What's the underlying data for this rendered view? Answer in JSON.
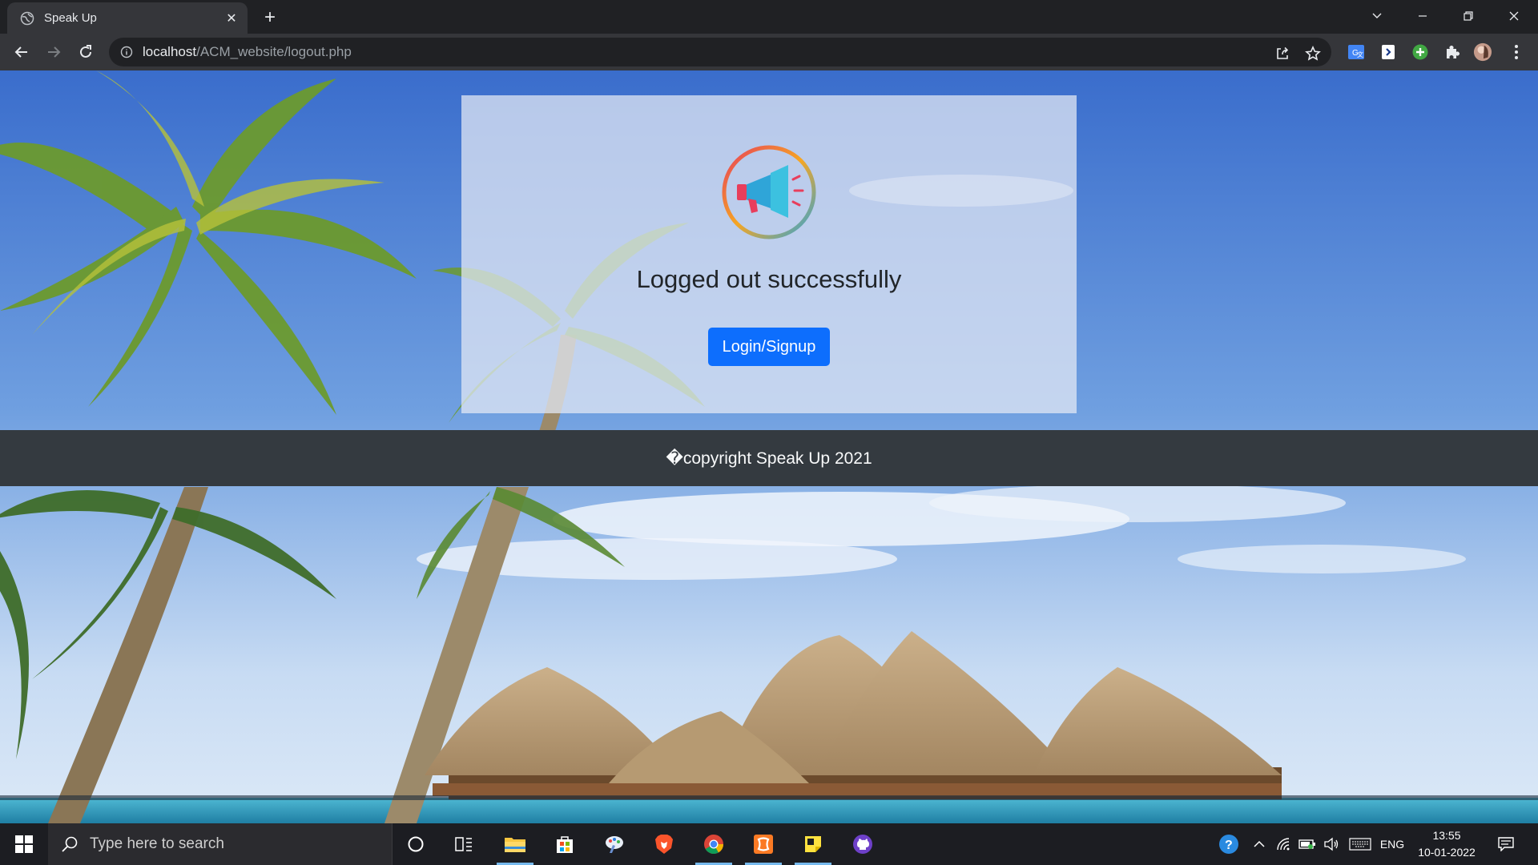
{
  "browser": {
    "tab_title": "Speak Up",
    "url_host": "localhost",
    "url_path": "/ACM_website/logout.php"
  },
  "page": {
    "heading": "Logged out successfully",
    "login_button": "Login/Signup",
    "footer_text": "�copyright Speak Up 2021"
  },
  "taskbar": {
    "search_placeholder": "Type here to search",
    "language": "ENG",
    "time": "13:55",
    "date": "10-01-2022"
  },
  "colors": {
    "primary_button": "#0d6efd",
    "footer_bg": "#343a40",
    "chrome_dark": "#202124",
    "chrome_toolbar": "#35363a"
  },
  "icons": [
    "globe-icon",
    "close-icon",
    "plus-icon",
    "back-icon",
    "forward-icon",
    "reload-icon",
    "info-icon",
    "share-icon",
    "star-icon",
    "translate-icon",
    "extension-icon",
    "puzzle-icon",
    "profile-avatar",
    "menu-icon",
    "megaphone-icon",
    "windows-icon",
    "search-icon",
    "cortana-icon",
    "task-view-icon",
    "file-explorer-icon",
    "store-icon",
    "brave-icon",
    "chrome-icon",
    "xampp-icon",
    "sticky-notes-icon",
    "github-icon",
    "help-icon",
    "chevron-up-icon",
    "network-icon",
    "battery-icon",
    "volume-icon",
    "keyboard-icon",
    "notification-icon"
  ]
}
